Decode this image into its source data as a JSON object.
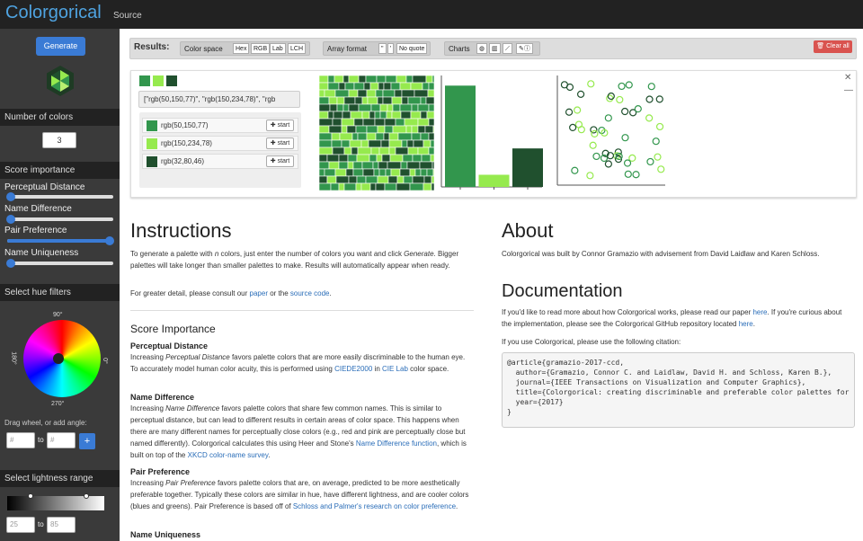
{
  "topbar": {
    "brand": "Colorgorical",
    "source": "Source"
  },
  "sidebar": {
    "generate": "Generate",
    "num_colors_head": "Number of colors",
    "num_colors": "3",
    "score_head": "Score importance",
    "sliders": [
      {
        "label": "Perceptual Distance",
        "value": 0
      },
      {
        "label": "Name Difference",
        "value": 0
      },
      {
        "label": "Pair Preference",
        "value": 1
      },
      {
        "label": "Name Uniqueness",
        "value": 0
      }
    ],
    "hue_head": "Select hue filters",
    "deg90": "90°",
    "deg180": "180°",
    "deg270": "270°",
    "deg0": "0°",
    "drag_text": "Drag wheel, or add angle:",
    "angle_ph": "#",
    "to": "to",
    "add": "+",
    "light_head": "Select lightness range",
    "light_from": "25",
    "light_to": "85"
  },
  "results": {
    "label": "Results:",
    "color_space": "Color space",
    "cs_opts": [
      "Hex",
      "RGB",
      "Lab",
      "LCH"
    ],
    "array_format": "Array format",
    "af_opts": [
      "\"",
      "'",
      "No quote"
    ],
    "charts": "Charts",
    "clear": "🗑 Clear all"
  },
  "palette": {
    "colors": [
      "#32964d",
      "#96ea4e",
      "#20502e"
    ],
    "array_text": "[\"rgb(50,150,77)\", \"rgb(150,234,78)\", \"rgb",
    "items": [
      {
        "label": "rgb(50,150,77)",
        "color": "#32964d",
        "btn": "✚ start"
      },
      {
        "label": "rgb(150,234,78)",
        "color": "#96ea4e",
        "btn": "✚ start"
      },
      {
        "label": "rgb(32,80,46)",
        "color": "#20502e",
        "btn": "✚ start"
      }
    ]
  },
  "chart_data": {
    "type": "bar",
    "categories": [
      "rgb(50,150,77)",
      "rgb(150,234,78)",
      "rgb(32,80,46)"
    ],
    "values": [
      100,
      12,
      38
    ],
    "ylim": [
      0,
      110
    ]
  },
  "instructions": {
    "title": "Instructions",
    "p1a": "To generate a palette with ",
    "p1n": "n",
    "p1b": " colors, just enter the number of colors you want and click ",
    "p1g": "Generate",
    "p1c": ". Bigger palettes will take longer than smaller palettes to make. Results will automatically appear when ready.",
    "p2a": "For greater detail, please consult our ",
    "p2paper": "paper",
    "p2b": " or the ",
    "p2src": "source code",
    "p2c": ".",
    "score_title": "Score Importance",
    "pd_title": "Perceptual Distance",
    "pd_a": "Increasing ",
    "pd_i": "Perceptual Distance",
    "pd_b": " favors palette colors that are more easily discriminable to the human eye. To accurately model human color acuity, this is performed using ",
    "pd_l1": "CIEDE2000",
    "pd_c": " in ",
    "pd_l2": "CIE Lab",
    "pd_d": " color space.",
    "nd_title": "Name Difference",
    "nd_a": "Increasing ",
    "nd_i": "Name Difference",
    "nd_b": " favors palette colors that share few common names. This is similar to perceptual distance, but can lead to different results in certain areas of color space. This happens when there are many different names for perceptually close colors (e.g., red and pink are perceptually close but named differently). Colorgorical calculates this using Heer and Stone's ",
    "nd_l1": "Name Difference function",
    "nd_c": ", which is built on top of the ",
    "nd_l2": "XKCD color-name survey",
    "nd_d": ".",
    "pp_title": "Pair Preference",
    "pp_a": "Increasing ",
    "pp_i": "Pair Preference",
    "pp_b": " favors palette colors that are, on average, predicted to be more aesthetically preferable together. Typically these colors are similar in hue, have different lightness, and are cooler colors (blues and greens). Pair Preference is based off of ",
    "pp_l": "Schloss and Palmer's research on color preference",
    "pp_c": ".",
    "nu_title": "Name Uniqueness"
  },
  "about": {
    "title": "About",
    "p": "Colorgorical was built by Connor Gramazio with advisement from David Laidlaw and Karen Schloss.",
    "doc_title": "Documentation",
    "d1a": "If you'd like to read more about how Colorgorical works, please read our paper ",
    "d1l": "here",
    "d1b": ". If you're curious about the implementation, please see the Colorgorical GitHub repository located ",
    "d1l2": "here",
    "d1c": ".",
    "d2": "If you use Colorgorical, please use the following citation:",
    "citation": "@article{gramazio-2017-ccd,\n  author={Gramazio, Connor C. and Laidlaw, David H. and Schloss, Karen B.},\n  journal={IEEE Transactions on Visualization and Computer Graphics},\n  title={Colorgorical: creating discriminable and preferable color palettes for\n  year={2017}\n}"
  }
}
